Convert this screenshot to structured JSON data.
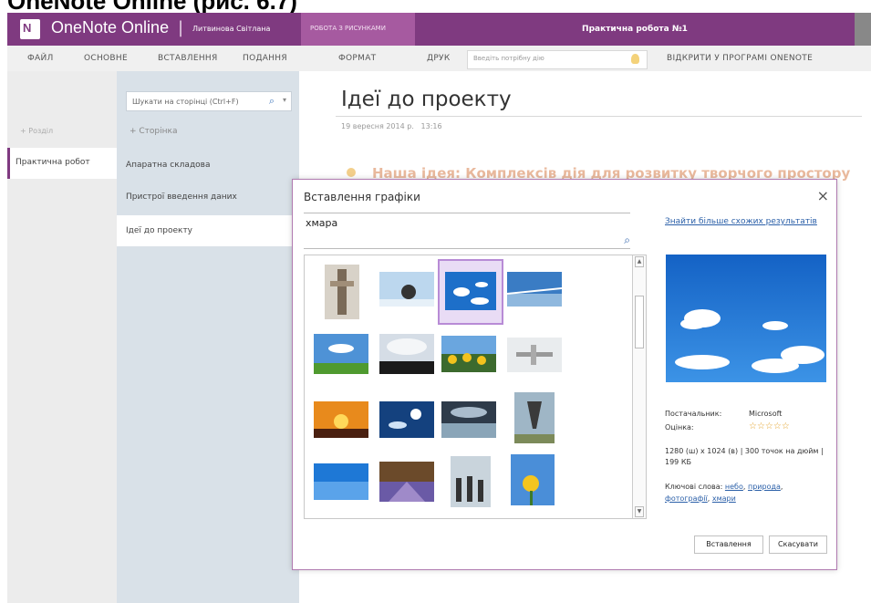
{
  "slide_caption": "OneNote Online (рис. 6.7)",
  "app": {
    "logo_letter": "N",
    "name": "OneNote Online",
    "separator": "|",
    "user": "Литвинова Світлана",
    "contextual_tab": "РОБОТА З РИСУНКАМИ",
    "document_title": "Практична робота №1"
  },
  "ribbon": {
    "tabs": [
      "ФАЙЛ",
      "ОСНОВНЕ",
      "ВСТАВЛЕННЯ",
      "ПОДАННЯ",
      "ФОРМАТ",
      "ДРУК"
    ],
    "tell_me_placeholder": "Введіть потрібну дію",
    "open_in_app": "ВІДКРИТИ У ПРОГРАМІ ONENOTE"
  },
  "sections": {
    "add_label": "+  Розділ",
    "items": [
      "Практична робот"
    ]
  },
  "pages": {
    "search_placeholder": "Шукати на сторінці (Ctrl+F)",
    "add_label": "+  Сторінка",
    "items": [
      "Апаратна складова",
      "Пристрої введення даних",
      "Ідеї до проекту"
    ]
  },
  "page": {
    "title": "Ідеї до проекту",
    "date": "19 вересня 2014 р.",
    "time": "13:16",
    "bg_text": "Наша ідея: Комплексів дія для розвитку творчого простору"
  },
  "dialog": {
    "title": "Вставлення графіки",
    "close": "×",
    "query": "хмара",
    "more_link": "Знайти більше схожих результатів",
    "source_label": "Постачальник:",
    "source_value": "Microsoft",
    "rating_label": "Оцінка:",
    "rating_stars": "☆☆☆☆☆",
    "size_info": "1280 (ш) x 1024 (в) | 300 точок на дюйм | 199 КБ",
    "keywords_label": "Ключові слова:",
    "keywords": [
      "небо",
      "природа",
      "фотографії",
      "хмари"
    ],
    "insert_button": "Вставлення",
    "cancel_button": "Скасувати"
  },
  "colors": {
    "brand": "#7f3a80",
    "context_tab": "#a65aa0",
    "link": "#2a5fa8"
  }
}
